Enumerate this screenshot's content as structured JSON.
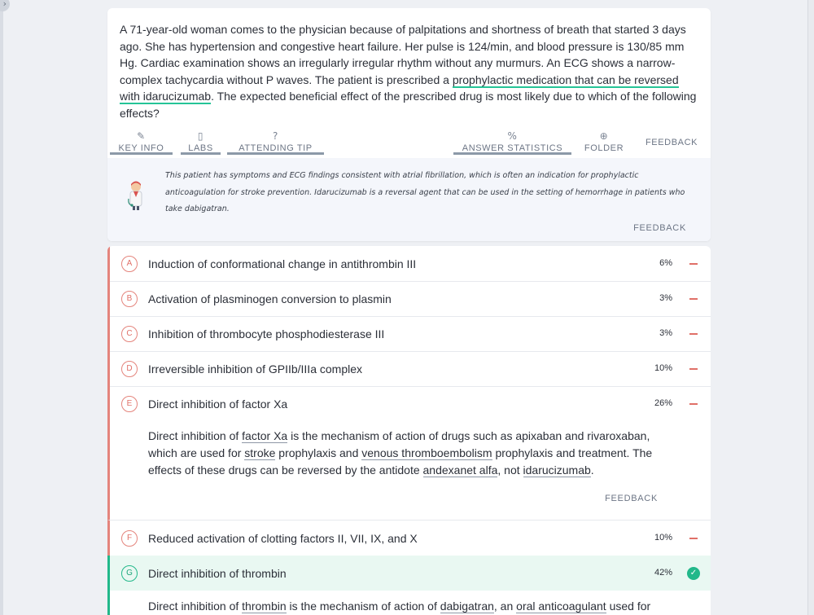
{
  "question": {
    "stem_part1": "A 71-year-old woman comes to the physician because of palpitations and shortness of breath that started 3 days ago. She has hypertension and congestive heart failure. Her pulse is 124/min, and blood pressure is 130/85 mm Hg. Cardiac examination shows an irregularly irregular rhythm without any murmurs. An ECG shows a narrow-complex tachycardia without P waves. The patient is prescribed a ",
    "stem_highlight": "prophylactic medication that can be reversed with idarucizumab",
    "stem_part2": ". The expected beneficial effect of the prescribed drug is most likely due to which of the following effects?"
  },
  "toolbar": {
    "key_info": "KEY INFO",
    "labs": "LABS",
    "attending_tip": "ATTENDING TIP",
    "answer_statistics": "ANSWER STATISTICS",
    "folder": "FOLDER",
    "feedback": "FEEDBACK"
  },
  "tip": {
    "text": "This patient has symptoms and ECG findings consistent with atrial fibrillation, which is often an indication for prophylactic anticoagulation for stroke prevention. Idarucizumab is a reversal agent that can be used in the setting of hemorrhage in patients who take dabigatran.",
    "feedback": "FEEDBACK"
  },
  "answers": [
    {
      "letter": "A",
      "text": "Induction of conformational change in antithrombin III",
      "pct": "6%"
    },
    {
      "letter": "B",
      "text": "Activation of plasminogen conversion to plasmin",
      "pct": "3%"
    },
    {
      "letter": "C",
      "text": "Inhibition of thrombocyte phosphodiesterase III",
      "pct": "3%"
    },
    {
      "letter": "D",
      "text": "Irreversible inhibition of GPIIb/IIIa complex",
      "pct": "10%"
    },
    {
      "letter": "E",
      "text": "Direct inhibition of factor Xa",
      "pct": "26%"
    },
    {
      "letter": "F",
      "text": "Reduced activation of clotting factors II, VII, IX, and X",
      "pct": "10%"
    },
    {
      "letter": "G",
      "text": "Direct inhibition of thrombin",
      "pct": "42%"
    }
  ],
  "explanation_e": {
    "t1": "Direct inhibition of ",
    "l1": "factor Xa",
    "t2": " is the mechanism of action of drugs such as apixaban and rivaroxaban, which are used for ",
    "l2": "stroke",
    "t3": " prophylaxis and ",
    "l3": "venous thromboembolism",
    "t4": " prophylaxis and treatment. The effects of these drugs can be reversed by the antidote ",
    "l4": "andexanet alfa",
    "t5": ", not ",
    "l5": "idarucizumab",
    "t6": ".",
    "feedback": "FEEDBACK"
  },
  "explanation_g": {
    "t1": "Direct inhibition of ",
    "l1": "thrombin",
    "t2": " is the mechanism of action of ",
    "l2": "dabigatran",
    "t3": ", an ",
    "l3": "oral anticoagulant",
    "t4": " used for"
  },
  "colors": {
    "wrong": "#e4847c",
    "correct": "#22b88a",
    "highlight": "#25c497"
  },
  "icons": {
    "key_info": "pencil-icon",
    "labs": "clipboard-icon",
    "attending_tip": "question-circle-icon",
    "answer_statistics": "percent-icon",
    "folder": "plus-circle-icon",
    "wrong_marker": "minus-icon",
    "correct_marker": "check-circle-icon",
    "expand": "chevron-right-icon"
  }
}
